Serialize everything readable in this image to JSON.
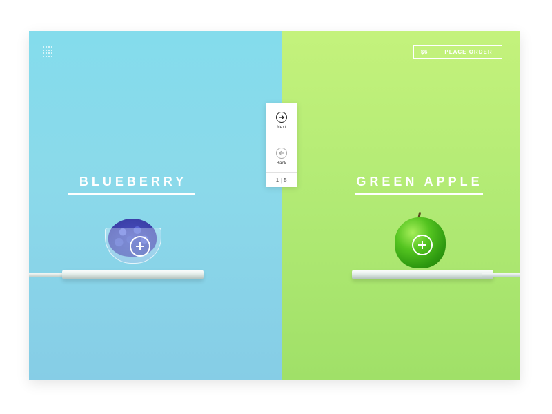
{
  "order": {
    "price": "$6",
    "button_label": "PLACE ORDER"
  },
  "left": {
    "title": "BLUEBERRY",
    "color": "#86d6ea"
  },
  "right": {
    "title": "GREEN APPLE",
    "color": "#b4ec74"
  },
  "nav": {
    "next_label": "Next",
    "back_label": "Back",
    "current_page": "1",
    "total_pages": "5"
  },
  "icons": {
    "menu": "grid-menu-icon",
    "next": "arrow-right-circle-icon",
    "back": "arrow-left-circle-icon",
    "add": "plus-circle-icon"
  }
}
